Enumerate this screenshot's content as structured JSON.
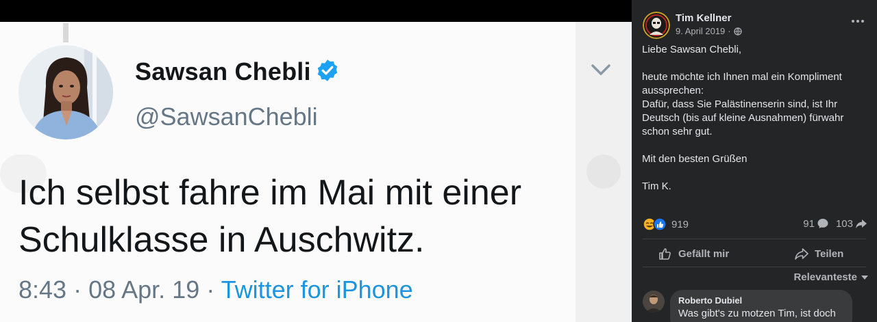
{
  "tweet": {
    "display_name": "Sawsan Chebli",
    "handle": "@SawsanChebli",
    "text_line1": "Ich selbst fahre im Mai mit einer",
    "text_line2": "Schulklasse in Auschwitz.",
    "time": "8:43",
    "date": "08 Apr. 19",
    "separator": " · ",
    "source": "Twitter for iPhone",
    "verified_icon": "verified-badge-icon",
    "chevron_icon": "chevron-down-icon",
    "colors": {
      "text": "#14171a",
      "muted": "#657786",
      "link": "#1b95e0",
      "verified": "#1da1f2"
    }
  },
  "post": {
    "author": "Tim Kellner",
    "date": "9. April 2019",
    "date_separator": "·",
    "audience_icon": "globe-icon",
    "more_icon": "more-horizontal-icon",
    "text": "Liebe Sawsan Chebli,\n\nheute möchte ich Ihnen mal ein Kompliment aussprechen:\nDafür, dass Sie Palästinenserin sind, ist Ihr Deutsch (bis auf kleine Ausnahmen) fürwahr schon sehr gut.\n\nMit den besten Grüßen\n\nTim K.",
    "reactions_count": "919",
    "comments_count": "91",
    "shares_count": "103",
    "like_label": "Gefällt mir",
    "share_label": "Teilen",
    "sort_label": "Relevanteste",
    "colors": {
      "background": "#242526",
      "text": "#e4e6eb",
      "muted": "#b0b3b8",
      "bubble": "#3a3b3c"
    }
  },
  "comment": {
    "author": "Roberto Dubiel",
    "text": "Was gibt's zu motzen Tim, ist doch"
  }
}
